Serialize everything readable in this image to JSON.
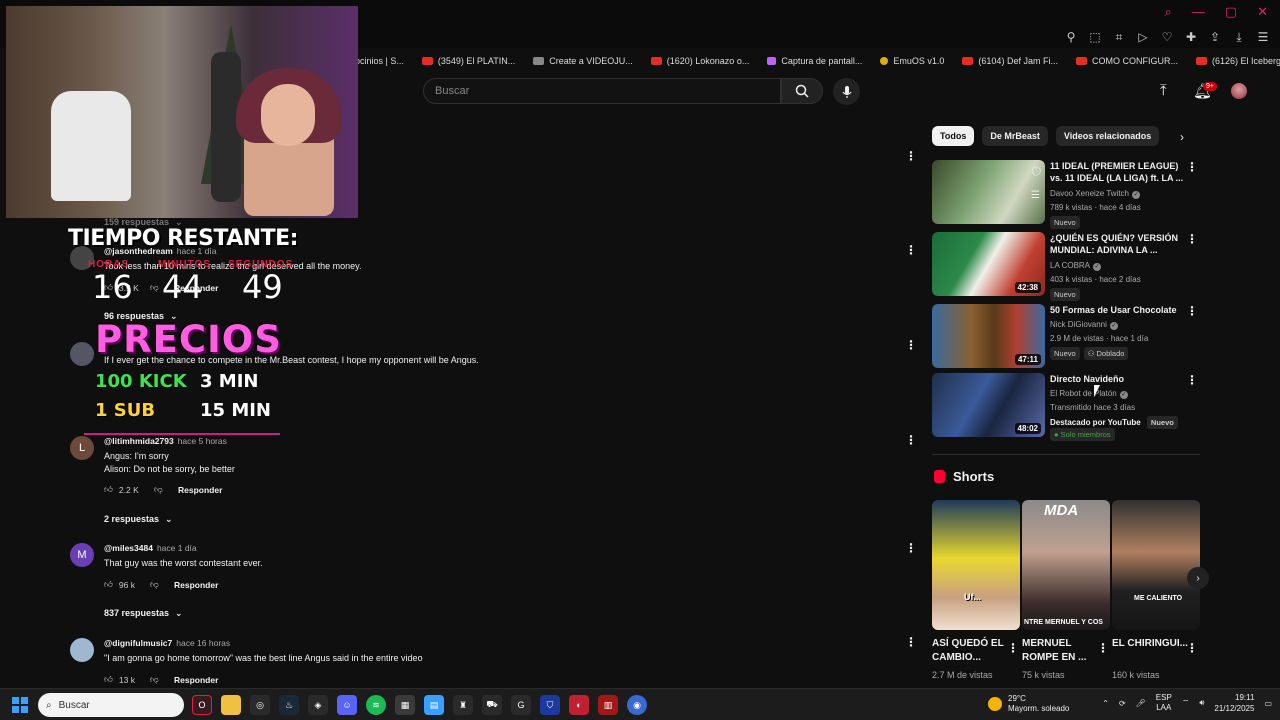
{
  "bookmarks": [
    {
      "label": "ocinios | S...",
      "icon": "none"
    },
    {
      "label": "(3549) El PLATIN...",
      "icon": "youtube-icon"
    },
    {
      "label": "Create a VIDEOJU...",
      "icon": "page-icon"
    },
    {
      "label": "(1620) Lokonazo o...",
      "icon": "youtube-icon"
    },
    {
      "label": "Captura de pantall...",
      "icon": "pen-icon"
    },
    {
      "label": "EmuOS v1.0",
      "icon": "emu-icon"
    },
    {
      "label": "(6104) Def Jam Fi...",
      "icon": "youtube-icon"
    },
    {
      "label": "COMO CONFIGUR...",
      "icon": "youtube-icon"
    },
    {
      "label": "(6126) El Iceberg...",
      "icon": "youtube-icon"
    }
  ],
  "header": {
    "search_placeholder": "Buscar",
    "notif_count": "9+"
  },
  "overlay": {
    "timer_title": "TIEMPO RESTANTE:",
    "labels": [
      "HORAS",
      "MINUTOS",
      "SEGUNDOS"
    ],
    "hours": "16",
    "minutes": "44",
    "seconds": "49",
    "prices_title": "PRECIOS",
    "kick_label": "100 KICK",
    "kick_time": "3 MIN",
    "sub_label": "1 SUB",
    "sub_time": "15 MIN"
  },
  "comments": {
    "top_replies": "159 respuestas",
    "c1": {
      "user": "@jasonthedream",
      "time": "hace 1 día",
      "text": "Took less than 10 mins to realize the girl deserved all the money.",
      "likes": "3.5 K",
      "reply": "Responder",
      "replies": "96 respuestas"
    },
    "c2": {
      "user": "",
      "time": "",
      "text": "If I ever get the chance to compete in the Mr.Beast contest, I hope my opponent will be Angus.",
      "likes": "",
      "reply": "Responder",
      "replies": "2 respuestas"
    },
    "c3": {
      "user": "@litimhmida2793",
      "time": "hace 5 horas",
      "text1": "Angus: I'm sorry",
      "text2": "Alison: Do not be sorry, be better",
      "likes": "2.2 K",
      "reply": "Responder",
      "replies": "2 respuestas",
      "initial": "L"
    },
    "c4": {
      "user": "@miles3484",
      "time": "hace 1 día",
      "text": "That guy was the worst contestant ever.",
      "likes": "96 k",
      "reply": "Responder",
      "replies": "837 respuestas",
      "initial": "M"
    },
    "c5": {
      "user": "@dignifulmusic7",
      "time": "hace 16 horas",
      "text": "\"I am gonna go home tomorrow\" was the best line Angus said in the entire video",
      "likes": "13 k",
      "reply": "Responder"
    }
  },
  "chips": [
    "Todos",
    "De MrBeast",
    "Videos relacionados"
  ],
  "related": [
    {
      "title": "11 IDEAL (PREMIER LEAGUE) vs. 11 IDEAL (LA LIGA) ft. LA ...",
      "channel": "Davoo Xeneize Twitch",
      "meta": "789 k vistas · hace 4 días",
      "badge": "Nuevo",
      "duration": ""
    },
    {
      "title": "¿QUIÉN ES QUIÉN? VERSIÓN MUNDIAL: ADIVINA LA ...",
      "channel": "LA COBRA",
      "meta": "403 k vistas · hace 2 días",
      "badge": "Nuevo",
      "duration": "42:38"
    },
    {
      "title": "50 Formas de Usar Chocolate",
      "channel": "Nick DiGiovanni",
      "meta": "2.9 M de vistas · hace 1 día",
      "badge": "Nuevo",
      "badge2": "Doblado",
      "duration": "47:11"
    },
    {
      "title": "Directo Navideño",
      "channel": "El Robot de Platón",
      "meta": "Transmitido hace 3 días",
      "extra": "Destacado por YouTube",
      "badge": "Nuevo",
      "members": "Solo miembros",
      "duration": "48:02"
    }
  ],
  "shorts": {
    "heading": "Shorts",
    "items": [
      {
        "title": "ASÍ QUEDÓ EL CAMBIO...",
        "views": "2.7 M de vistas",
        "caption": "Uf..."
      },
      {
        "title": "MERNUEL ROMPE EN ...",
        "views": "75 k vistas",
        "caption": "NTRE MERNUEL Y COS"
      },
      {
        "title": "EL CHIRINGUI...",
        "views": "160 k vistas",
        "caption": "ME CALIENTO"
      }
    ]
  },
  "taskbar": {
    "search": "Buscar",
    "weather_temp": "29°C",
    "weather_desc": "Mayorm. soleado",
    "lang1": "ESP",
    "lang2": "LAA",
    "time": "19:11",
    "date": "21/12/2025"
  }
}
